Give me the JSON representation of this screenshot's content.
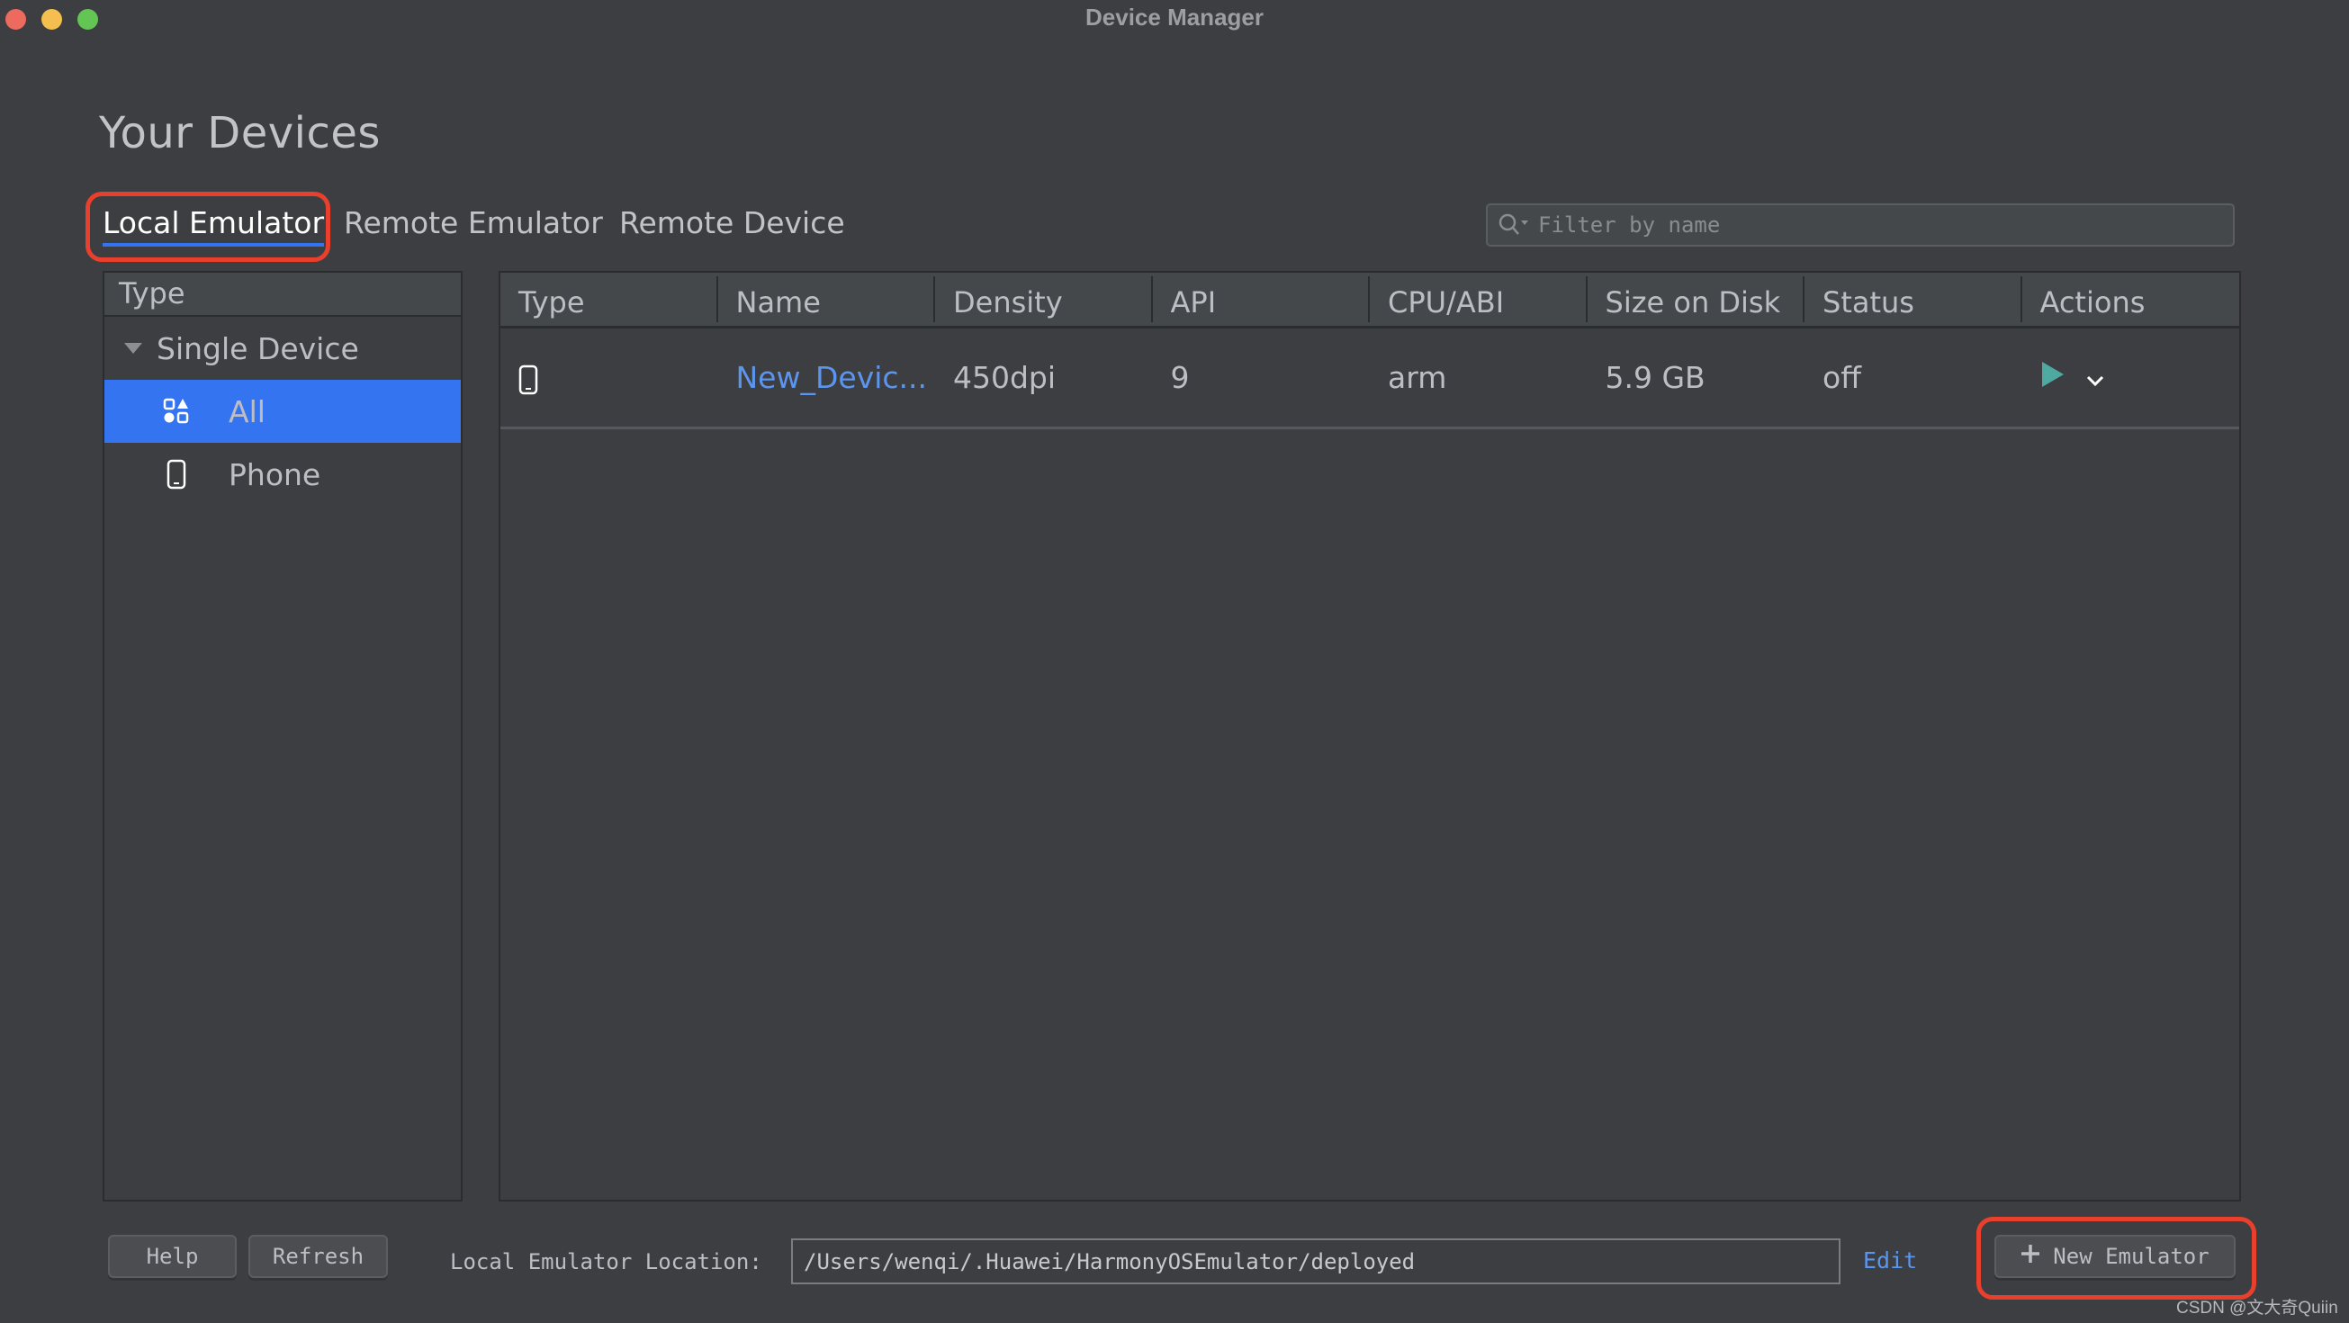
{
  "window": {
    "title": "Device Manager",
    "traffic_lights": [
      "close",
      "minimize",
      "maximize"
    ]
  },
  "page": {
    "title": "Your Devices"
  },
  "tabs": [
    {
      "label": "Local Emulator",
      "active": true,
      "highlighted": true
    },
    {
      "label": "Remote Emulator",
      "active": false
    },
    {
      "label": "Remote Device",
      "active": false
    }
  ],
  "filter": {
    "placeholder": "Filter by name",
    "value": "",
    "icon": "search-icon"
  },
  "sidebar": {
    "header": "Type",
    "group": {
      "label": "Single Device",
      "expanded": true
    },
    "items": [
      {
        "label": "All",
        "icon": "all-types-icon",
        "selected": true
      },
      {
        "label": "Phone",
        "icon": "phone-icon",
        "selected": false
      }
    ]
  },
  "table": {
    "columns": [
      "Type",
      "Name",
      "Density",
      "API",
      "CPU/ABI",
      "Size on Disk",
      "Status",
      "Actions"
    ],
    "rows": [
      {
        "type_icon": "phone-icon",
        "name": "New_Devic...",
        "density": "450dpi",
        "api": "9",
        "cpu_abi": "arm",
        "size_on_disk": "5.9 GB",
        "status": "off",
        "actions": [
          "run-icon",
          "chevron-down-icon"
        ]
      }
    ]
  },
  "footer": {
    "help_label": "Help",
    "refresh_label": "Refresh",
    "location_label": "Local Emulator Location:",
    "location_value": "/Users/wenqi/.Huawei/HarmonyOSEmulator/deployed",
    "edit_label": "Edit",
    "new_emulator_label": "New Emulator",
    "new_emulator_highlighted": true
  },
  "watermark": "CSDN @文大奇Quiin",
  "colors": {
    "background": "#3d3e41",
    "accent": "#3574f0",
    "link": "#5c95ee",
    "run": "#4eaaa0",
    "highlight": "#e8402c"
  }
}
